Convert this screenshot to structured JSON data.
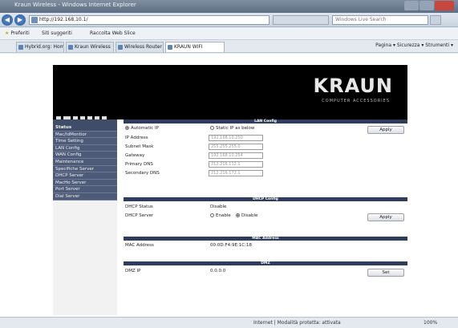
{
  "window": {
    "title": "Kraun Wireless - Windows Internet Explorer"
  },
  "address": {
    "url": "http://192.168.10.1/",
    "search_placeholder": "Windows Live Search"
  },
  "favorites": {
    "label": "Preferiti",
    "items": [
      "Siti suggeriti",
      "Raccolta Web Slice"
    ]
  },
  "tabs": [
    "Hybrid.org: Home",
    "Kraun Wireless",
    "Wireless Router",
    "KRAUN WIFI"
  ],
  "toolbar": {
    "items": "Pagina ▾  Sicurezza ▾  Strumenti ▾"
  },
  "brand": {
    "logo": "KRAUN",
    "tagline": "COMPUTER ACCESSORIES"
  },
  "sidebar": {
    "items": [
      "Status",
      "Mac/IdMontior",
      "Time Setting",
      "LAN Config",
      "WAN Config",
      "Maintenance",
      "Specifiche Server",
      "DHCP Server",
      "MacHo Server",
      "Port Server",
      "Dial Server"
    ]
  },
  "lan": {
    "title": "LAN Config",
    "auto_ip": "Automatic IP",
    "static_ip": "Static IP as below",
    "ip_label": "IP Address",
    "ip_value": "192.168.10.250",
    "mask_label": "Subnet Mask",
    "mask_value": "255.255.255.0",
    "gw_label": "Gateway",
    "gw_value": "192.168.10.254",
    "dns1_label": "Primary DNS",
    "dns1_value": "212.216.112.1",
    "dns2_label": "Secondary DNS",
    "dns2_value": "212.216.172.1",
    "apply": "Apply"
  },
  "dhcp": {
    "title": "DHCP Config",
    "status_label": "DHCP Status",
    "status_value": "Disable",
    "server_label": "DHCP Server",
    "enable": "Enable",
    "disable": "Disable",
    "apply": "Apply"
  },
  "mac": {
    "title": "MAC Address",
    "label": "MAC Address",
    "value": "00:0D:F4:9E:1C:18"
  },
  "dmz": {
    "title": "DMZ",
    "label": "DMZ IP",
    "value": "0.0.0.0",
    "set": "Set"
  },
  "status": {
    "zone": "Internet | Modalità protetta: attivata",
    "zoom": "100%"
  }
}
